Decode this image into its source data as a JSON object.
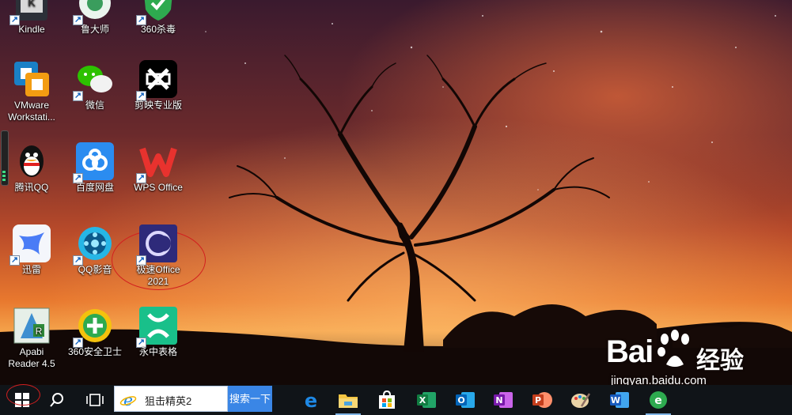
{
  "desktop": {
    "icons": [
      {
        "label": "Kindle"
      },
      {
        "label": "鲁大师"
      },
      {
        "label": "360杀毒"
      },
      {
        "label": "VMware\nWorkstati..."
      },
      {
        "label": "微信"
      },
      {
        "label": "剪映专业版"
      },
      {
        "label": "腾讯QQ"
      },
      {
        "label": "百度网盘"
      },
      {
        "label": "WPS Office"
      },
      {
        "label": "迅雷"
      },
      {
        "label": "QQ影音"
      },
      {
        "label": "极速Office\n2021"
      },
      {
        "label": "Apabi\nReader 4.5"
      },
      {
        "label": "360安全卫士"
      },
      {
        "label": "永中表格"
      }
    ]
  },
  "taskbar": {
    "search_text": "狙击精英2",
    "search_button": "搜索一下",
    "apps": [
      "start-icon",
      "search-icon",
      "task-view-icon",
      "ie-icon",
      "edge-icon",
      "file-explorer-icon",
      "store-icon",
      "excel-icon",
      "outlook-icon",
      "onenote-icon",
      "powerpoint-icon",
      "paint-icon",
      "word-icon",
      "360-browser-icon"
    ]
  },
  "watermark": {
    "brand": "Bai",
    "brand_cn": "经验",
    "url": "jingyan.baidu.com"
  },
  "colors": {
    "taskbar": "#101418",
    "annotation": "#d21f1f",
    "search_button": "#3a86e6"
  }
}
